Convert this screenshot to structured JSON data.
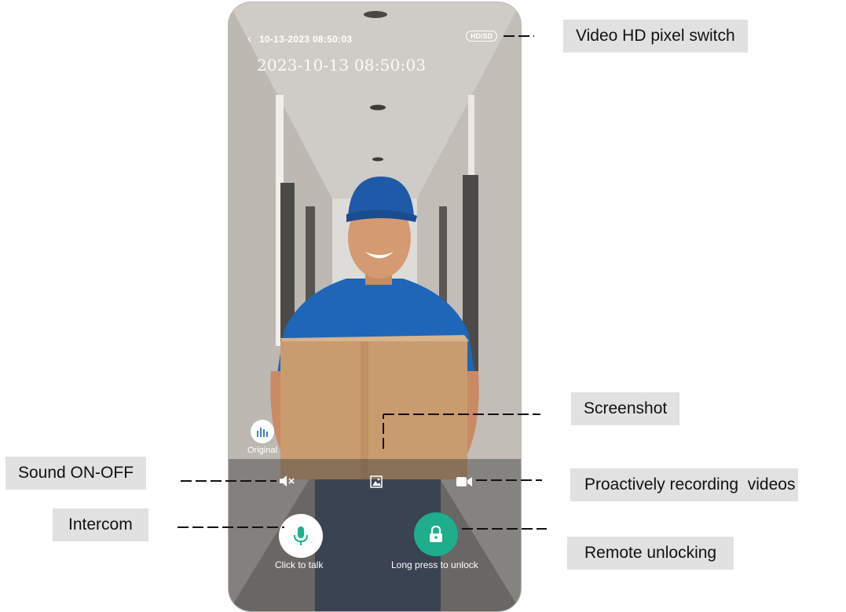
{
  "app": {
    "datetime_header": "10-13-2023 08:50:03",
    "quality_toggle": "HD/SD",
    "video_timestamp": "2023-10-13 08:50:03",
    "original_label": "Original",
    "talk_label": "Click to talk",
    "unlock_label": "Long press to unlock"
  },
  "icons": {
    "back": "chevron-left-icon",
    "original": "audio-bars-icon",
    "mute": "speaker-mute-icon",
    "screenshot": "image-icon",
    "record": "video-camera-icon",
    "talk": "microphone-icon",
    "unlock": "padlock-icon"
  },
  "callouts": {
    "hd_switch": "Video HD pixel switch",
    "screenshot": "Screenshot",
    "sound": "Sound ON-OFF",
    "recording": "Proactively recording  videos",
    "intercom": "Intercom",
    "unlock": "Remote unlocking"
  },
  "colors": {
    "unlock_accent": "#1eae8c",
    "talk_icon": "#1eae8c",
    "callout_bg": "#e1e1e1"
  }
}
